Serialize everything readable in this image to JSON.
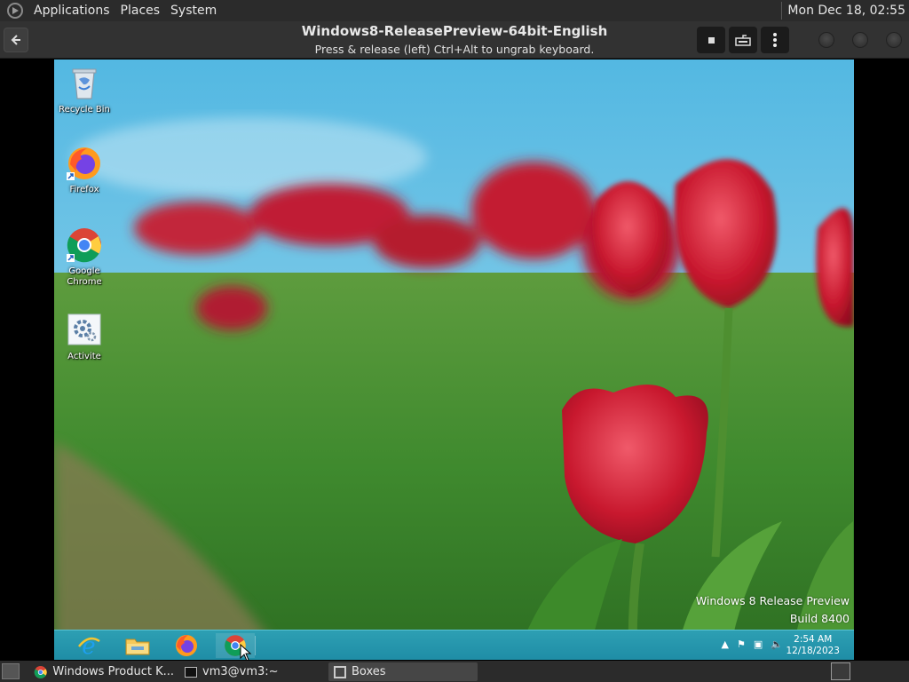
{
  "top_panel": {
    "menus": [
      "Applications",
      "Places",
      "System"
    ],
    "clock": "Mon Dec 18, 02:55"
  },
  "boxes": {
    "title": "Windows8-ReleasePreview-64bit-English",
    "hint": "Press & release (left) Ctrl+Alt to ungrab keyboard."
  },
  "desktop": {
    "icons": [
      {
        "label": "Recycle Bin"
      },
      {
        "label": "Firefox"
      },
      {
        "label": "Google Chrome"
      },
      {
        "label": "Activite"
      }
    ],
    "watermark_line1": "Windows 8 Release Preview",
    "watermark_line2": "Build 8400"
  },
  "win_taskbar": {
    "time": "2:54 AM",
    "date": "12/18/2023"
  },
  "bottom_panel": {
    "tasks": [
      {
        "label": "Windows Product K..."
      },
      {
        "label": "vm3@vm3:~"
      },
      {
        "label": "Boxes"
      }
    ]
  },
  "colors": {
    "panel_bg": "#2b2b2b",
    "header_bg": "#323232",
    "taskbar": "#2d9fb3"
  }
}
